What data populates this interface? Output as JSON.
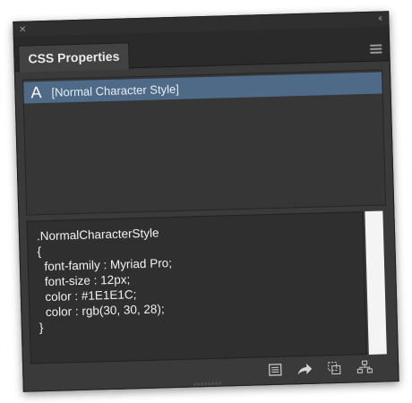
{
  "panel": {
    "close_glyph": "×",
    "collapse_glyph": "‹‹",
    "tab_label": "CSS Properties"
  },
  "styles_list": {
    "items": [
      {
        "icon": "A",
        "label": "[Normal Character Style]",
        "selected": true
      }
    ]
  },
  "code_view": {
    "lines": [
      ".NormalCharacterStyle",
      "{",
      "  font-family : Myriad Pro;",
      "  font-size : 12px;",
      "  color : #1E1E1C;",
      "  color : rgb(30, 30, 28);",
      "}"
    ]
  },
  "toolbar": {
    "icons": [
      "list-view-icon",
      "share-arrow-icon",
      "copy-css-icon",
      "export-hierarchy-icon"
    ]
  },
  "colors": {
    "panel_bg": "#3a3a3a",
    "selection": "#4e6a87",
    "text": "#f2f2f2"
  }
}
